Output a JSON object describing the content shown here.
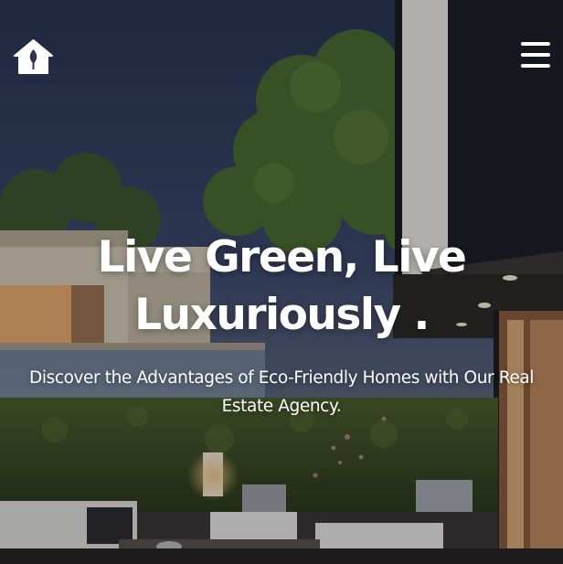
{
  "header": {
    "logo_icon": "house-leaf-icon",
    "menu_icon": "hamburger-menu-icon"
  },
  "hero": {
    "title_line_1": "Live Green, Live",
    "title_line_2": "Luxuriously .",
    "subtitle_line_1": "Discover the Advantages of Eco-Friendly Homes with Our Real",
    "subtitle_line_2": "Estate Agency."
  },
  "colors": {
    "text": "#ffffff",
    "sky": "#2d3b5c",
    "foliage": "#3f5a28",
    "wall_dark": "#1b1d22",
    "hedge": "#3c4d1f"
  }
}
